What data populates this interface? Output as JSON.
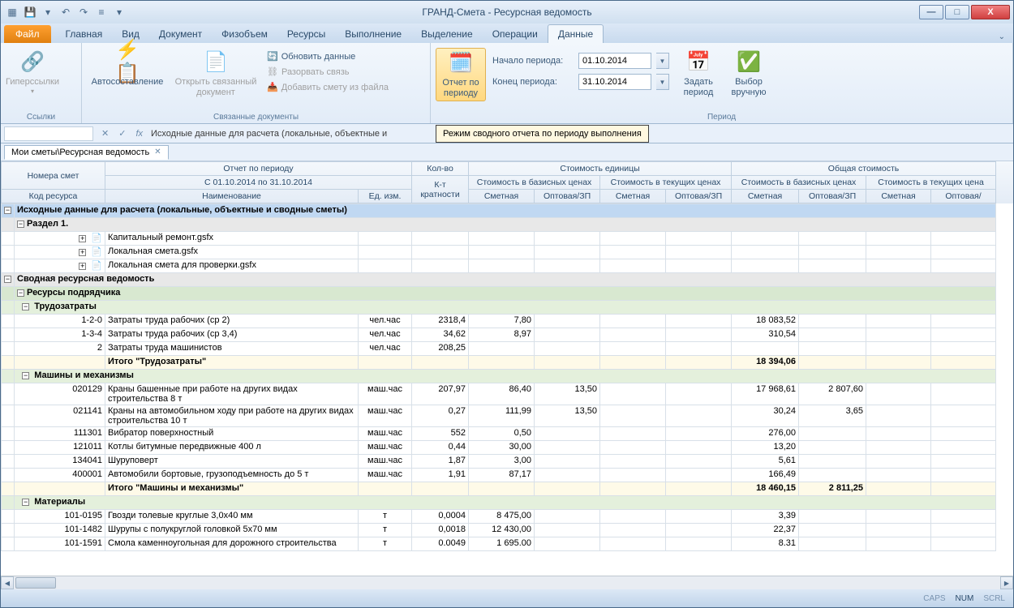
{
  "app_title": "ГРАНД-Смета - Ресурсная ведомость",
  "ribbon": {
    "file": "Файл",
    "tabs": [
      "Главная",
      "Вид",
      "Документ",
      "Физобъем",
      "Ресурсы",
      "Выполнение",
      "Выделение",
      "Операции",
      "Данные"
    ],
    "active_tab": "Данные",
    "groups": {
      "links": {
        "label": "Ссылки",
        "hyperlinks": "Гиперссылки"
      },
      "linked_docs": {
        "label": "Связанные документы",
        "auto_compose": "Автосоставление",
        "open_linked": "Открыть связанный документ",
        "update_data": "Обновить данные",
        "break_link": "Разорвать связь",
        "add_from_file": "Добавить смету из файла"
      },
      "period": {
        "label": "Период",
        "report_by_period": "Отчет по периоду",
        "start_label": "Начало периода:",
        "end_label": "Конец периода:",
        "start_val": "01.10.2014",
        "end_val": "31.10.2014",
        "set_period": "Задать период",
        "manual_select": "Выбор вручную"
      }
    },
    "tooltip": "Режим сводного отчета по периоду выполнения"
  },
  "formula_bar": {
    "text": "Исходные данные для расчета (локальные, объектные и"
  },
  "doc_tab": "Мои сметы\\Ресурсная ведомость",
  "headers": {
    "smeta_numbers": "Номера смет",
    "resource_code": "Код ресурса",
    "report_title": "Отчет по периоду",
    "report_range": "С 01.10.2014 по 31.10.2014",
    "name": "Наименование",
    "unit": "Ед. изм.",
    "qty": "Кол-во",
    "mult": "К-т кратности",
    "unit_cost": "Стоимость единицы",
    "total_cost": "Общая стоимость",
    "base_prices": "Стоимость в базисных ценах",
    "current_prices": "Стоимость в текущих ценах",
    "current_prices_cut": "Стоимость в текущих цена",
    "smeta": "Сметная",
    "wholesale": "Оптовая/ЗП",
    "wholesale_cut": "Оптовая/"
  },
  "rows": {
    "sec1": "Исходные данные для расчета (локальные, объектные и сводные сметы)",
    "razdel1": "Раздел 1.",
    "files": [
      "Капитальный ремонт.gsfx",
      "Локальная смета.gsfx",
      "Локальная смета для проверки.gsfx"
    ],
    "sec2": "Сводная ресурсная ведомость",
    "contractor": "Ресурсы подрядчика",
    "labor_h": "Трудозатраты",
    "labor": [
      {
        "code": "1-2-0",
        "name": "Затраты труда рабочих (ср 2)",
        "unit": "чел.час",
        "qty": "2318,4",
        "p1": "7,80",
        "t1": "18 083,52"
      },
      {
        "code": "1-3-4",
        "name": "Затраты труда рабочих (ср 3,4)",
        "unit": "чел.час",
        "qty": "34,62",
        "p1": "8,97",
        "t1": "310,54"
      },
      {
        "code": "2",
        "name": "Затраты труда машинистов",
        "unit": "чел.час",
        "qty": "208,25",
        "p1": "",
        "t1": ""
      }
    ],
    "labor_total_l": "Итого \"Трудозатраты\"",
    "labor_total_v": "18 394,06",
    "mach_h": "Машины и механизмы",
    "mach": [
      {
        "code": "020129",
        "name": "Краны башенные при работе на других видах строительства 8 т",
        "unit": "маш.час",
        "qty": "207,97",
        "p1": "86,40",
        "p2": "13,50",
        "t1": "17 968,61",
        "t2": "2 807,60"
      },
      {
        "code": "021141",
        "name": "Краны на автомобильном ходу при работе на других видах строительства 10 т",
        "unit": "маш.час",
        "qty": "0,27",
        "p1": "111,99",
        "p2": "13,50",
        "t1": "30,24",
        "t2": "3,65"
      },
      {
        "code": "111301",
        "name": "Вибратор поверхностный",
        "unit": "маш.час",
        "qty": "552",
        "p1": "0,50",
        "p2": "",
        "t1": "276,00",
        "t2": ""
      },
      {
        "code": "121011",
        "name": "Котлы битумные передвижные 400 л",
        "unit": "маш.час",
        "qty": "0,44",
        "p1": "30,00",
        "p2": "",
        "t1": "13,20",
        "t2": ""
      },
      {
        "code": "134041",
        "name": "Шуруповерт",
        "unit": "маш.час",
        "qty": "1,87",
        "p1": "3,00",
        "p2": "",
        "t1": "5,61",
        "t2": ""
      },
      {
        "code": "400001",
        "name": "Автомобили бортовые, грузоподъемность до 5 т",
        "unit": "маш.час",
        "qty": "1,91",
        "p1": "87,17",
        "p2": "",
        "t1": "166,49",
        "t2": ""
      }
    ],
    "mach_total_l": "Итого \"Машины и механизмы\"",
    "mach_total_v1": "18 460,15",
    "mach_total_v2": "2 811,25",
    "mat_h": "Материалы",
    "mat": [
      {
        "code": "101-0195",
        "name": "Гвозди толевые круглые 3,0x40 мм",
        "unit": "т",
        "qty": "0,0004",
        "p1": "8 475,00",
        "t1": "3,39"
      },
      {
        "code": "101-1482",
        "name": "Шурупы с полукруглой головкой 5x70 мм",
        "unit": "т",
        "qty": "0,0018",
        "p1": "12 430,00",
        "t1": "22,37"
      },
      {
        "code": "101-1591",
        "name": "Смола каменноугольная для дорожного строительства",
        "unit": "т",
        "qty": "0.0049",
        "p1": "1 695.00",
        "t1": "8.31"
      }
    ]
  },
  "status": {
    "caps": "CAPS",
    "num": "NUM",
    "scrl": "SCRL"
  }
}
